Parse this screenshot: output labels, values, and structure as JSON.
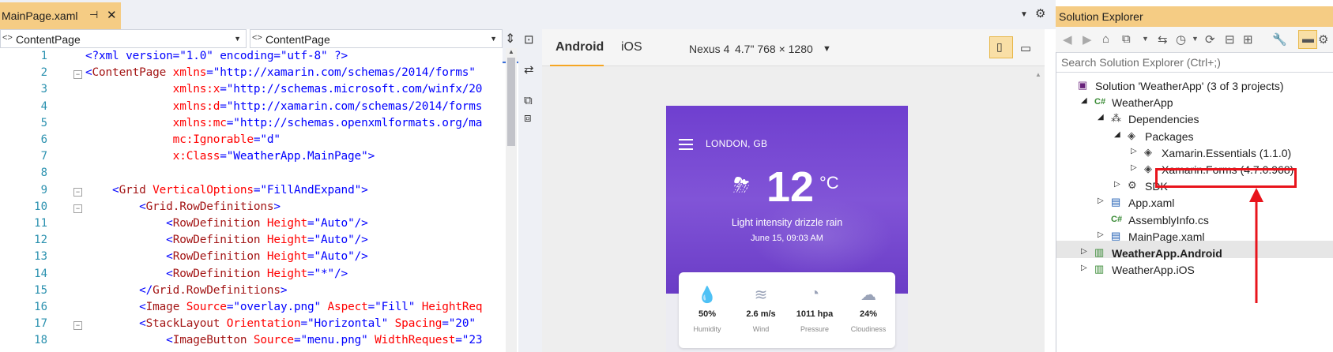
{
  "window": {
    "tab_title": "MainPage.xaml",
    "tab_pin_glyph": "⊣",
    "tab_close_glyph": "✕"
  },
  "navigation": {
    "left_scope": "ContentPage",
    "right_scope": "ContentPage"
  },
  "code": {
    "line_numbers": [
      "1",
      "2",
      "3",
      "4",
      "5",
      "6",
      "7",
      "8",
      "9",
      "10",
      "11",
      "12",
      "13",
      "14",
      "15",
      "16",
      "17",
      "18"
    ],
    "lines": [
      [
        {
          "t": "<?xml version=\"1.0\" encoding=\"utf-8\" ?>",
          "c": "p"
        }
      ],
      [
        {
          "t": "<",
          "c": "p"
        },
        {
          "t": "ContentPage",
          "c": "e"
        },
        {
          "t": " xmlns",
          "c": "a"
        },
        {
          "t": "=\"http://xamarin.com/schemas/2014/forms\"",
          "c": "v"
        }
      ],
      [
        {
          "t": "             xmlns:x",
          "c": "a"
        },
        {
          "t": "=\"http://schemas.microsoft.com/winfx/20",
          "c": "v"
        }
      ],
      [
        {
          "t": "             xmlns:d",
          "c": "a"
        },
        {
          "t": "=\"http://xamarin.com/schemas/2014/forms",
          "c": "v"
        }
      ],
      [
        {
          "t": "             xmlns:mc",
          "c": "a"
        },
        {
          "t": "=\"http://schemas.openxmlformats.org/ma",
          "c": "v"
        }
      ],
      [
        {
          "t": "             mc:Ignorable",
          "c": "a"
        },
        {
          "t": "=\"d\"",
          "c": "v"
        }
      ],
      [
        {
          "t": "             x:Class",
          "c": "a"
        },
        {
          "t": "=\"WeatherApp.MainPage\">",
          "c": "v"
        }
      ],
      [
        {
          "t": "",
          "c": "p"
        }
      ],
      [
        {
          "t": "    <",
          "c": "p"
        },
        {
          "t": "Grid",
          "c": "e"
        },
        {
          "t": " VerticalOptions",
          "c": "a"
        },
        {
          "t": "=\"FillAndExpand\">",
          "c": "v"
        }
      ],
      [
        {
          "t": "        <",
          "c": "p"
        },
        {
          "t": "Grid.RowDefinitions",
          "c": "e"
        },
        {
          "t": ">",
          "c": "p"
        }
      ],
      [
        {
          "t": "            <",
          "c": "p"
        },
        {
          "t": "RowDefinition",
          "c": "e"
        },
        {
          "t": " Height",
          "c": "a"
        },
        {
          "t": "=\"Auto\"/>",
          "c": "v"
        }
      ],
      [
        {
          "t": "            <",
          "c": "p"
        },
        {
          "t": "RowDefinition",
          "c": "e"
        },
        {
          "t": " Height",
          "c": "a"
        },
        {
          "t": "=\"Auto\"/>",
          "c": "v"
        }
      ],
      [
        {
          "t": "            <",
          "c": "p"
        },
        {
          "t": "RowDefinition",
          "c": "e"
        },
        {
          "t": " Height",
          "c": "a"
        },
        {
          "t": "=\"Auto\"/>",
          "c": "v"
        }
      ],
      [
        {
          "t": "            <",
          "c": "p"
        },
        {
          "t": "RowDefinition",
          "c": "e"
        },
        {
          "t": " Height",
          "c": "a"
        },
        {
          "t": "=\"*\"/>",
          "c": "v"
        }
      ],
      [
        {
          "t": "        </",
          "c": "p"
        },
        {
          "t": "Grid.RowDefinitions",
          "c": "e"
        },
        {
          "t": ">",
          "c": "p"
        }
      ],
      [
        {
          "t": "        <",
          "c": "p"
        },
        {
          "t": "Image",
          "c": "e"
        },
        {
          "t": " Source",
          "c": "a"
        },
        {
          "t": "=\"overlay.png\"",
          "c": "v"
        },
        {
          "t": " Aspect",
          "c": "a"
        },
        {
          "t": "=\"Fill\"",
          "c": "v"
        },
        {
          "t": " HeightReq",
          "c": "a"
        }
      ],
      [
        {
          "t": "        <",
          "c": "p"
        },
        {
          "t": "StackLayout",
          "c": "e"
        },
        {
          "t": " Orientation",
          "c": "a"
        },
        {
          "t": "=\"Horizontal\"",
          "c": "v"
        },
        {
          "t": " Spacing",
          "c": "a"
        },
        {
          "t": "=\"20\"",
          "c": "v"
        }
      ],
      [
        {
          "t": "            <",
          "c": "p"
        },
        {
          "t": "ImageButton",
          "c": "e"
        },
        {
          "t": " Source",
          "c": "a"
        },
        {
          "t": "=\"menu.png\"",
          "c": "v"
        },
        {
          "t": " WidthRequest",
          "c": "a"
        },
        {
          "t": "=\"23",
          "c": "v"
        }
      ]
    ],
    "fold_lines": [
      2,
      9,
      10,
      17
    ]
  },
  "previewer": {
    "platform_tabs": [
      "Android",
      "iOS"
    ],
    "active_tab": "Android",
    "device": {
      "name": "Nexus 4",
      "spec": "4.7\" 768 × 1280"
    },
    "app": {
      "location": "LONDON, GB",
      "temperature": "12",
      "unit": "°C",
      "condition": "Light intensity drizzle rain",
      "datetime": "June 15, 09:03 AM",
      "stats": [
        {
          "value": "50%",
          "label": "Humidity",
          "icon": "drop-icon",
          "glyph": "💧"
        },
        {
          "value": "2.6 m/s",
          "label": "Wind",
          "icon": "wind-icon",
          "glyph": "≋"
        },
        {
          "value": "1011 hpa",
          "label": "Pressure",
          "icon": "gauge-icon",
          "glyph": "◔"
        },
        {
          "value": "24%",
          "label": "Cloudiness",
          "icon": "cloud-icon",
          "glyph": "☁"
        }
      ]
    }
  },
  "solution_explorer": {
    "title": "Solution Explorer",
    "search_placeholder": "Search Solution Explorer (Ctrl+;)",
    "tree": [
      {
        "label": "Solution 'WeatherApp' (3 of 3 projects)",
        "depth": 0,
        "expander": "",
        "icon": "solution-icon",
        "glyph": "▣",
        "color": "#68217a"
      },
      {
        "label": "WeatherApp",
        "depth": 1,
        "expander": "◢",
        "icon": "csharp-project-icon",
        "glyph": "C#",
        "color": "#388a34"
      },
      {
        "label": "Dependencies",
        "depth": 2,
        "expander": "◢",
        "icon": "dependencies-icon",
        "glyph": "⁂",
        "color": "#424242"
      },
      {
        "label": "Packages",
        "depth": 3,
        "expander": "◢",
        "icon": "package-icon",
        "glyph": "◈",
        "color": "#424242"
      },
      {
        "label": "Xamarin.Essentials (1.1.0)",
        "depth": 4,
        "expander": "▷",
        "icon": "nuget-package-icon",
        "glyph": "◈",
        "color": "#424242"
      },
      {
        "label": "Xamarin.Forms (4.7.0.968)",
        "depth": 4,
        "expander": "▷",
        "icon": "nuget-package-icon",
        "glyph": "◈",
        "color": "#424242"
      },
      {
        "label": "SDK",
        "depth": 3,
        "expander": "▷",
        "icon": "sdk-icon",
        "glyph": "⚙",
        "color": "#424242"
      },
      {
        "label": "App.xaml",
        "depth": 2,
        "expander": "▷",
        "icon": "xaml-file-icon",
        "glyph": "▤",
        "color": "#1e5cb3"
      },
      {
        "label": "AssemblyInfo.cs",
        "depth": 2,
        "expander": "",
        "icon": "csharp-file-icon",
        "glyph": "C#",
        "color": "#388a34"
      },
      {
        "label": "MainPage.xaml",
        "depth": 2,
        "expander": "▷",
        "icon": "xaml-file-icon",
        "glyph": "▤",
        "color": "#1e5cb3"
      },
      {
        "label": "WeatherApp.Android",
        "depth": 1,
        "expander": "▷",
        "icon": "android-project-icon",
        "glyph": "▥",
        "color": "#388a34",
        "bold": true
      },
      {
        "label": "WeatherApp.iOS",
        "depth": 1,
        "expander": "▷",
        "icon": "ios-project-icon",
        "glyph": "▥",
        "color": "#388a34"
      }
    ],
    "selected_item": "MainPage.xaml",
    "highlighted_item": "Xamarin.Forms (4.7.0.968)"
  },
  "annotation": {
    "highlight_color": "#e8141c"
  }
}
